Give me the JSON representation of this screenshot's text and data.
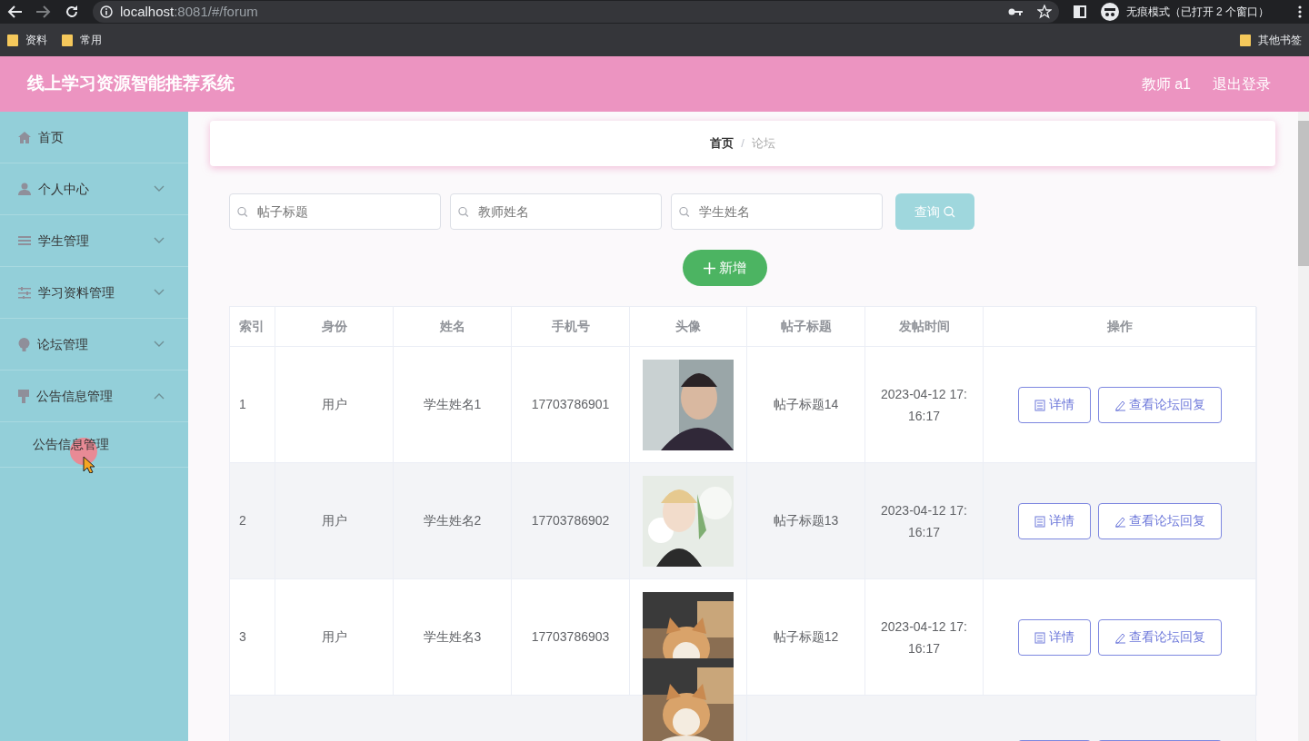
{
  "browser": {
    "url_host": "localhost",
    "url_rest": ":8081/#/forum",
    "incognito": "无痕模式（已打开 2 个窗口）",
    "bookmarks": [
      "资料",
      "常用"
    ],
    "other_bookmarks": "其他书签"
  },
  "header": {
    "title": "线上学习资源智能推荐系统",
    "user": "教师 a1",
    "logout": "退出登录"
  },
  "sidebar": {
    "items": [
      {
        "label": "首页"
      },
      {
        "label": "个人中心",
        "expanded": false
      },
      {
        "label": "学生管理",
        "expanded": false
      },
      {
        "label": "学习资料管理",
        "expanded": false
      },
      {
        "label": "论坛管理",
        "expanded": false
      },
      {
        "label": "公告信息管理",
        "expanded": true,
        "children": [
          {
            "label": "公告信息管理"
          }
        ]
      }
    ]
  },
  "breadcrumb": [
    {
      "label": "首页",
      "current": false
    },
    {
      "label": "论坛",
      "current": true
    }
  ],
  "breadcrumb_separator": "/",
  "search": {
    "fields": [
      {
        "placeholder": "帖子标题"
      },
      {
        "placeholder": "教师姓名"
      },
      {
        "placeholder": "学生姓名"
      }
    ],
    "button": "查询"
  },
  "add_button": "新增",
  "table": {
    "columns": [
      "索引",
      "身份",
      "姓名",
      "手机号",
      "头像",
      "帖子标题",
      "发帖时间",
      "操作"
    ],
    "rows": [
      {
        "index": "1",
        "role": "用户",
        "name": "学生姓名1",
        "phone": "17703786901",
        "avatar": {
          "kind": "picture"
        },
        "title": "帖子标题14",
        "time": "2023-04-12 17:16:17",
        "actions": [
          "详情",
          "查看论坛回复"
        ]
      },
      {
        "index": "2",
        "role": "用户",
        "name": "学生姓名2",
        "phone": "17703786902",
        "avatar": {
          "kind": "picture"
        },
        "title": "帖子标题13",
        "time": "2023-04-12 17:16:17",
        "actions": [
          "详情",
          "查看论坛回复"
        ]
      },
      {
        "index": "3",
        "role": "用户",
        "name": "学生姓名3",
        "phone": "17703786903",
        "avatar": {
          "kind": "picture"
        },
        "title": "帖子标题12",
        "time": "2023-04-12 17:16:17",
        "actions": [
          "详情",
          "查看论坛回复"
        ]
      }
    ]
  }
}
